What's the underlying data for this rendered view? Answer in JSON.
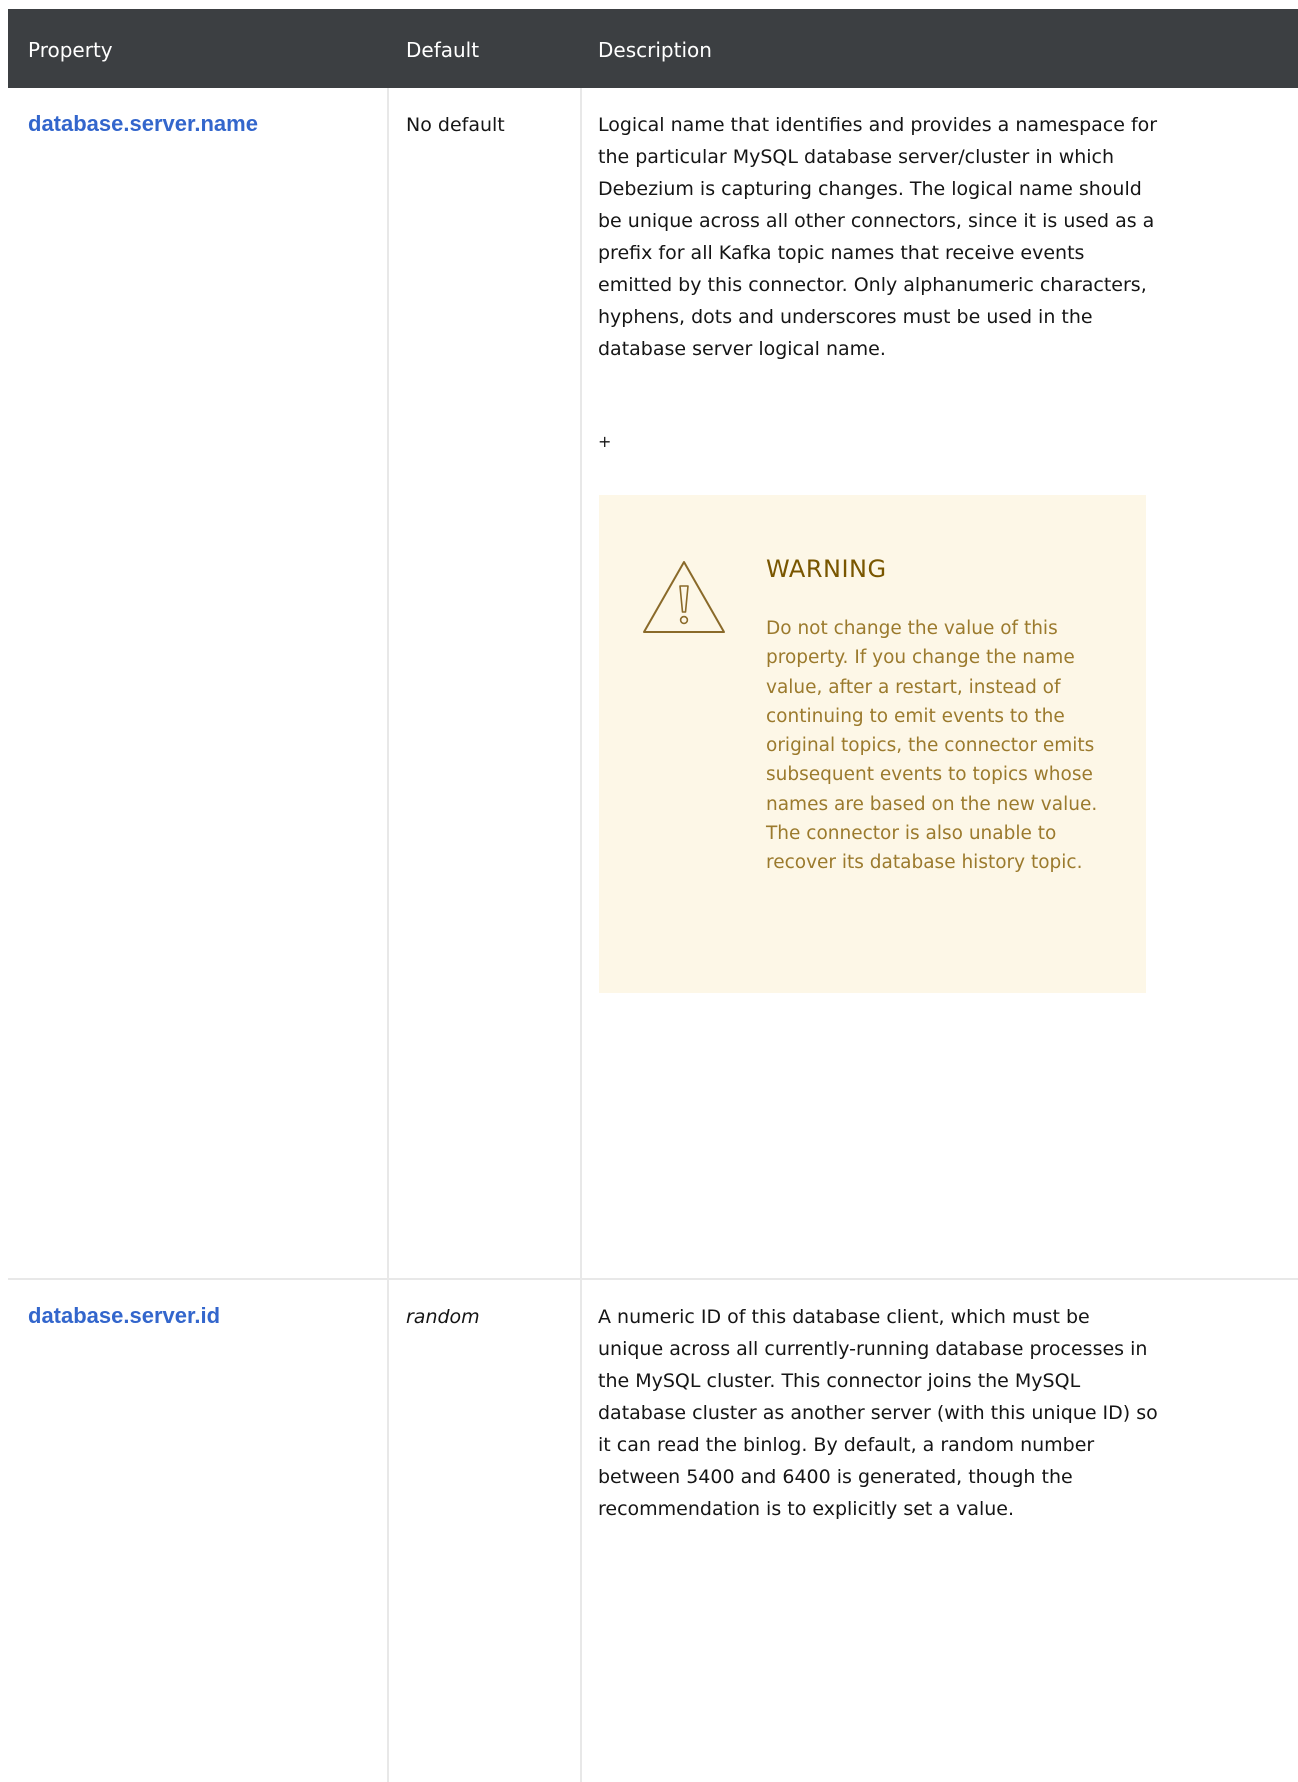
{
  "table": {
    "headers": {
      "property": "Property",
      "default": "Default",
      "description": "Description"
    },
    "rows": [
      {
        "property": "database.server.name",
        "default": "No default",
        "description": "Logical name that identifies and provides a namespace for the particular MySQL database server/cluster in which Debezium is capturing changes. The logical name should be unique across all other connectors, since it is used as a prefix for all Kafka topic names that receive events emitted by this connector. Only alphanumeric characters, hyphens, dots and underscores must be used in the database server logical name.",
        "continuation": "+",
        "warning": {
          "icon": "warning-triangle-icon",
          "title": "WARNING",
          "text": "Do not change the value of this property. If you change the name value, after a restart, instead of continuing to emit events to the original topics, the connector emits subsequent events to topics whose names are based on the new value. The connector is also unable to recover its database history topic."
        }
      },
      {
        "property": "database.server.id",
        "default": "random",
        "description": "A numeric ID of this database client, which must be unique across all currently-running database processes in the MySQL cluster. This connector joins the MySQL database cluster as another server (with this unique ID) so it can read the binlog. By default, a random number between 5400 and 6400 is generated, though the recommendation is to explicitly set a value."
      }
    ]
  },
  "colors": {
    "header_bg": "#3c3f42",
    "link": "#3366cc",
    "warning_bg": "#fdf7e7",
    "warning_title": "#795600",
    "warning_text": "#9b7a2d"
  }
}
